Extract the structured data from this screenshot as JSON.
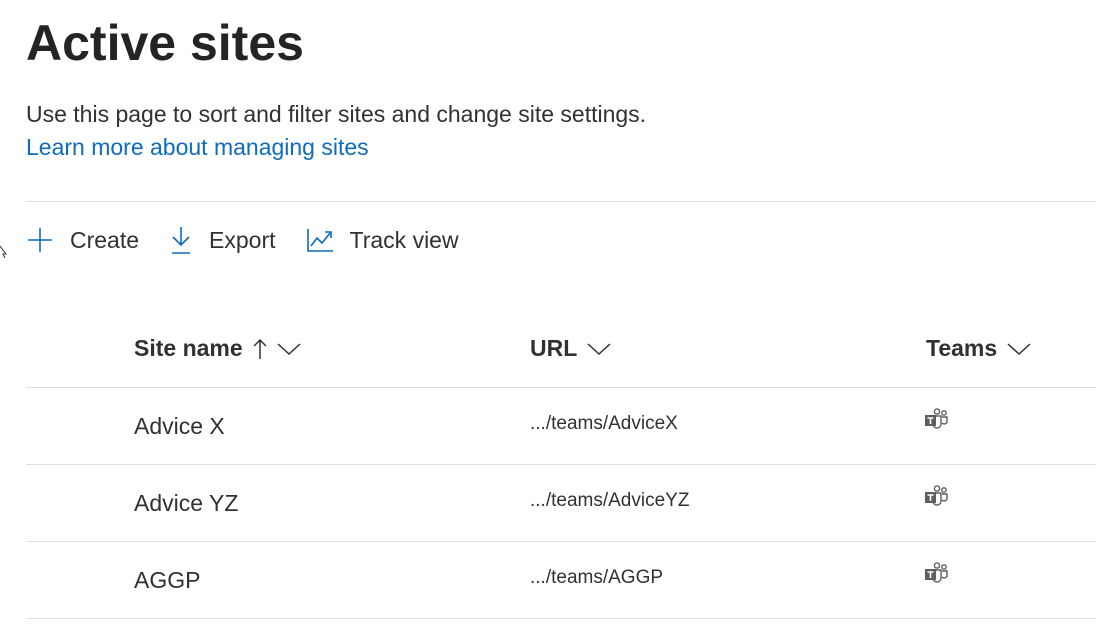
{
  "page": {
    "title": "Active sites",
    "description": "Use this page to sort and filter sites and change site settings.",
    "learn_more_link": "Learn more about managing sites"
  },
  "toolbar": {
    "create_label": "Create",
    "export_label": "Export",
    "track_view_label": "Track view"
  },
  "table": {
    "columns": {
      "site_name": "Site name",
      "url": "URL",
      "teams": "Teams"
    },
    "sort": {
      "column": "site_name",
      "direction": "ascending"
    },
    "rows": [
      {
        "site_name": "Advice X",
        "url": ".../teams/AdviceX",
        "teams_icon": "teams-icon"
      },
      {
        "site_name": "Advice YZ",
        "url": ".../teams/AdviceYZ",
        "teams_icon": "teams-icon"
      },
      {
        "site_name": "AGGP",
        "url": ".../teams/AGGP",
        "teams_icon": "teams-icon"
      }
    ]
  },
  "colors": {
    "accent": "#0f6cbd",
    "text": "#323130",
    "divider": "#e1dfdd"
  }
}
